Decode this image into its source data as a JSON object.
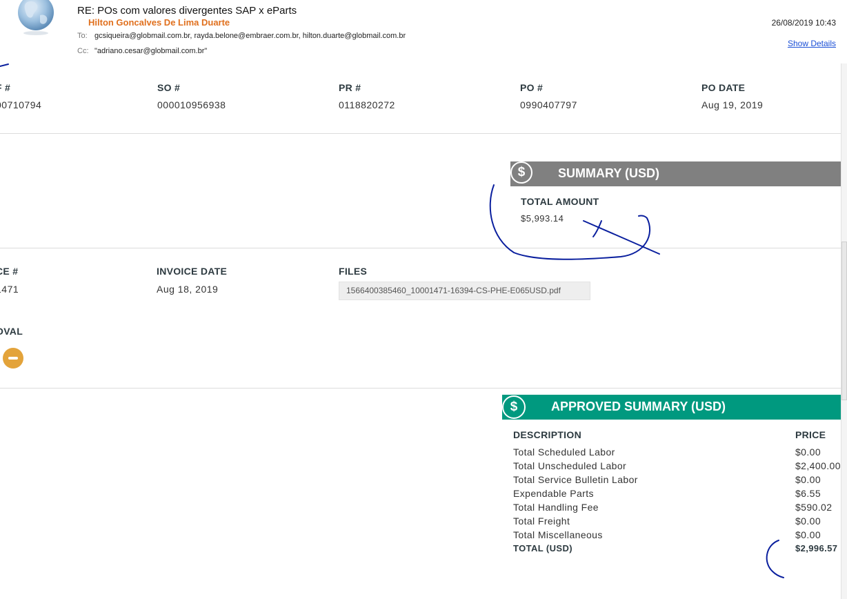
{
  "email": {
    "subject": "RE: POs com valores divergentes SAP x eParts",
    "sender": "Hilton Goncalves De Lima Duarte",
    "to_label": "To:",
    "to": "gcsiqueira@globmail.com.br, rayda.belone@embraer.com.br, hilton.duarte@globmail.com.br",
    "cc_label": "Cc:",
    "cc": "\"adriano.cesar@globmail.com.br\"",
    "date": "26/08/2019 10:43",
    "show_details": "Show Details"
  },
  "order": {
    "ref_label": "F #",
    "ref_value": "00710794",
    "so_label": "SO #",
    "so_value": "000010956938",
    "pr_label": "PR #",
    "pr_value": "0118820272",
    "po_label": "PO #",
    "po_value": "0990407797",
    "po_date_label": "PO DATE",
    "po_date_value": "Aug 19, 2019"
  },
  "summary": {
    "icon": "$",
    "title": "SUMMARY (USD)",
    "total_label": "TOTAL AMOUNT",
    "total_value": "$5,993.14"
  },
  "invoice": {
    "number_label": "CE #",
    "number_value": "1471",
    "date_label": "INVOICE DATE",
    "date_value": "Aug 18, 2019",
    "files_label": "FILES",
    "file_name": "1566400385460_10001471-16394-CS-PHE-E065USD.pdf",
    "approval_label": "OVAL"
  },
  "approved": {
    "icon": "$",
    "title": "APPROVED SUMMARY (USD)",
    "desc_header": "DESCRIPTION",
    "price_header": "PRICE",
    "rows": [
      {
        "desc": "Total Scheduled Labor",
        "price": "$0.00"
      },
      {
        "desc": "Total Unscheduled Labor",
        "price": "$2,400.00"
      },
      {
        "desc": "Total Service Bulletin Labor",
        "price": "$0.00"
      },
      {
        "desc": "Expendable Parts",
        "price": "$6.55"
      },
      {
        "desc": "Total Handling Fee",
        "price": "$590.02"
      },
      {
        "desc": "Total Freight",
        "price": "$0.00"
      },
      {
        "desc": "Total Miscellaneous",
        "price": "$0.00"
      }
    ],
    "total_label": "TOTAL (USD)",
    "total_value": "$2,996.57"
  },
  "colors": {
    "summary_bar": "#808080",
    "approved_bar": "#00997f",
    "sender": "#e0701e",
    "link": "#1a4fd6",
    "status_pending": "#e3a33a",
    "ink": "#0a1f9e"
  }
}
